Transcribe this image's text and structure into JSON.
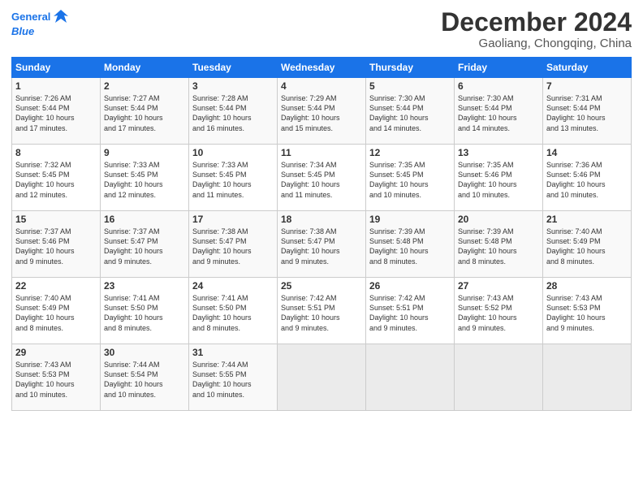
{
  "logo": {
    "line1": "General",
    "line2": "Blue"
  },
  "title": "December 2024",
  "subtitle": "Gaoliang, Chongqing, China",
  "weekdays": [
    "Sunday",
    "Monday",
    "Tuesday",
    "Wednesday",
    "Thursday",
    "Friday",
    "Saturday"
  ],
  "weeks": [
    [
      {
        "day": "1",
        "detail": "Sunrise: 7:26 AM\nSunset: 5:44 PM\nDaylight: 10 hours\nand 17 minutes."
      },
      {
        "day": "2",
        "detail": "Sunrise: 7:27 AM\nSunset: 5:44 PM\nDaylight: 10 hours\nand 17 minutes."
      },
      {
        "day": "3",
        "detail": "Sunrise: 7:28 AM\nSunset: 5:44 PM\nDaylight: 10 hours\nand 16 minutes."
      },
      {
        "day": "4",
        "detail": "Sunrise: 7:29 AM\nSunset: 5:44 PM\nDaylight: 10 hours\nand 15 minutes."
      },
      {
        "day": "5",
        "detail": "Sunrise: 7:30 AM\nSunset: 5:44 PM\nDaylight: 10 hours\nand 14 minutes."
      },
      {
        "day": "6",
        "detail": "Sunrise: 7:30 AM\nSunset: 5:44 PM\nDaylight: 10 hours\nand 14 minutes."
      },
      {
        "day": "7",
        "detail": "Sunrise: 7:31 AM\nSunset: 5:44 PM\nDaylight: 10 hours\nand 13 minutes."
      }
    ],
    [
      {
        "day": "8",
        "detail": "Sunrise: 7:32 AM\nSunset: 5:45 PM\nDaylight: 10 hours\nand 12 minutes."
      },
      {
        "day": "9",
        "detail": "Sunrise: 7:33 AM\nSunset: 5:45 PM\nDaylight: 10 hours\nand 12 minutes."
      },
      {
        "day": "10",
        "detail": "Sunrise: 7:33 AM\nSunset: 5:45 PM\nDaylight: 10 hours\nand 11 minutes."
      },
      {
        "day": "11",
        "detail": "Sunrise: 7:34 AM\nSunset: 5:45 PM\nDaylight: 10 hours\nand 11 minutes."
      },
      {
        "day": "12",
        "detail": "Sunrise: 7:35 AM\nSunset: 5:45 PM\nDaylight: 10 hours\nand 10 minutes."
      },
      {
        "day": "13",
        "detail": "Sunrise: 7:35 AM\nSunset: 5:46 PM\nDaylight: 10 hours\nand 10 minutes."
      },
      {
        "day": "14",
        "detail": "Sunrise: 7:36 AM\nSunset: 5:46 PM\nDaylight: 10 hours\nand 10 minutes."
      }
    ],
    [
      {
        "day": "15",
        "detail": "Sunrise: 7:37 AM\nSunset: 5:46 PM\nDaylight: 10 hours\nand 9 minutes."
      },
      {
        "day": "16",
        "detail": "Sunrise: 7:37 AM\nSunset: 5:47 PM\nDaylight: 10 hours\nand 9 minutes."
      },
      {
        "day": "17",
        "detail": "Sunrise: 7:38 AM\nSunset: 5:47 PM\nDaylight: 10 hours\nand 9 minutes."
      },
      {
        "day": "18",
        "detail": "Sunrise: 7:38 AM\nSunset: 5:47 PM\nDaylight: 10 hours\nand 9 minutes."
      },
      {
        "day": "19",
        "detail": "Sunrise: 7:39 AM\nSunset: 5:48 PM\nDaylight: 10 hours\nand 8 minutes."
      },
      {
        "day": "20",
        "detail": "Sunrise: 7:39 AM\nSunset: 5:48 PM\nDaylight: 10 hours\nand 8 minutes."
      },
      {
        "day": "21",
        "detail": "Sunrise: 7:40 AM\nSunset: 5:49 PM\nDaylight: 10 hours\nand 8 minutes."
      }
    ],
    [
      {
        "day": "22",
        "detail": "Sunrise: 7:40 AM\nSunset: 5:49 PM\nDaylight: 10 hours\nand 8 minutes."
      },
      {
        "day": "23",
        "detail": "Sunrise: 7:41 AM\nSunset: 5:50 PM\nDaylight: 10 hours\nand 8 minutes."
      },
      {
        "day": "24",
        "detail": "Sunrise: 7:41 AM\nSunset: 5:50 PM\nDaylight: 10 hours\nand 8 minutes."
      },
      {
        "day": "25",
        "detail": "Sunrise: 7:42 AM\nSunset: 5:51 PM\nDaylight: 10 hours\nand 9 minutes."
      },
      {
        "day": "26",
        "detail": "Sunrise: 7:42 AM\nSunset: 5:51 PM\nDaylight: 10 hours\nand 9 minutes."
      },
      {
        "day": "27",
        "detail": "Sunrise: 7:43 AM\nSunset: 5:52 PM\nDaylight: 10 hours\nand 9 minutes."
      },
      {
        "day": "28",
        "detail": "Sunrise: 7:43 AM\nSunset: 5:53 PM\nDaylight: 10 hours\nand 9 minutes."
      }
    ],
    [
      {
        "day": "29",
        "detail": "Sunrise: 7:43 AM\nSunset: 5:53 PM\nDaylight: 10 hours\nand 10 minutes."
      },
      {
        "day": "30",
        "detail": "Sunrise: 7:44 AM\nSunset: 5:54 PM\nDaylight: 10 hours\nand 10 minutes."
      },
      {
        "day": "31",
        "detail": "Sunrise: 7:44 AM\nSunset: 5:55 PM\nDaylight: 10 hours\nand 10 minutes."
      },
      null,
      null,
      null,
      null
    ]
  ]
}
